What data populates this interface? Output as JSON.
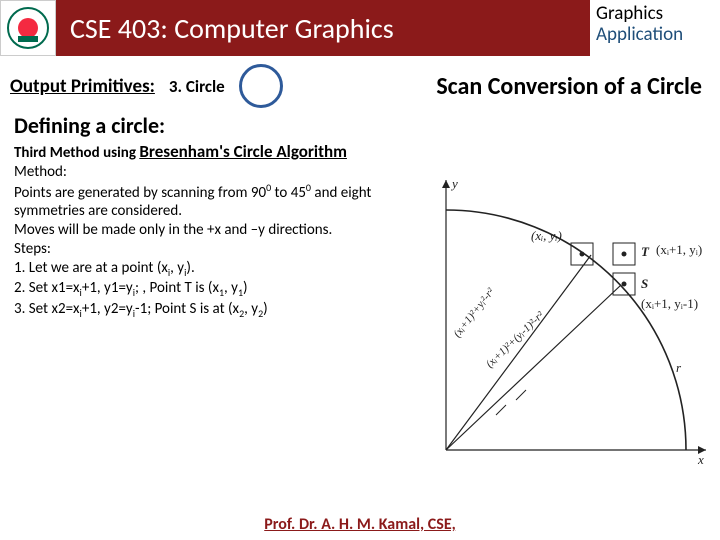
{
  "header": {
    "title": "CSE 403: Computer Graphics",
    "tab_line1": "Graphics",
    "tab_line2": "Application"
  },
  "subhead": {
    "output_primitives": "Output Primitives:",
    "topic": "3. Circle",
    "scan_title": "Scan Conversion of a Circle"
  },
  "section_heading": "Defining a circle:",
  "body": {
    "method_prefix": "Third Method using ",
    "method_name": "Bresenham's Circle Algorithm",
    "method_label": "Method:",
    "para1a": "Points are generated by scanning from 90",
    "para1b": " to 45",
    "para1c": " and eight symmetries are considered.",
    "para2": "Moves will be made only in the +x and –y directions.",
    "steps_label": "Steps:",
    "s1a": "1.  Let we are at a point (x",
    "s1b": ", y",
    "s1c": ").",
    "s2a": "2.  Set x1=x",
    "s2b": "+1, y1=y",
    "s2c": "; , Point T is (x",
    "s2d": ", y",
    "s2e": ")",
    "s3a": "3.  Set x2=x",
    "s3b": "+1, y2=y",
    "s3c": "-1; Point S is at (x",
    "s3d": ", y",
    "s3e": ")",
    "sub_i": "i",
    "sub_1": "1",
    "sub_2": "2",
    "deg0": "0"
  },
  "diagram": {
    "y_axis": "y",
    "x_axis": "x",
    "r_label": "r",
    "pt_xy": "(xᵢ, yᵢ)",
    "pt_T": "T",
    "pt_T_coord": "(xᵢ+1, yᵢ)",
    "pt_S": "S",
    "pt_S_coord": "(xᵢ+1, yᵢ-1)",
    "dist1": "(xᵢ+1)²+yᵢ²-r²",
    "dist2": "(xᵢ+1)²+(yᵢ-1)²-r²"
  },
  "footer": "Prof. Dr. A. H. M. Kamal, CSE,"
}
